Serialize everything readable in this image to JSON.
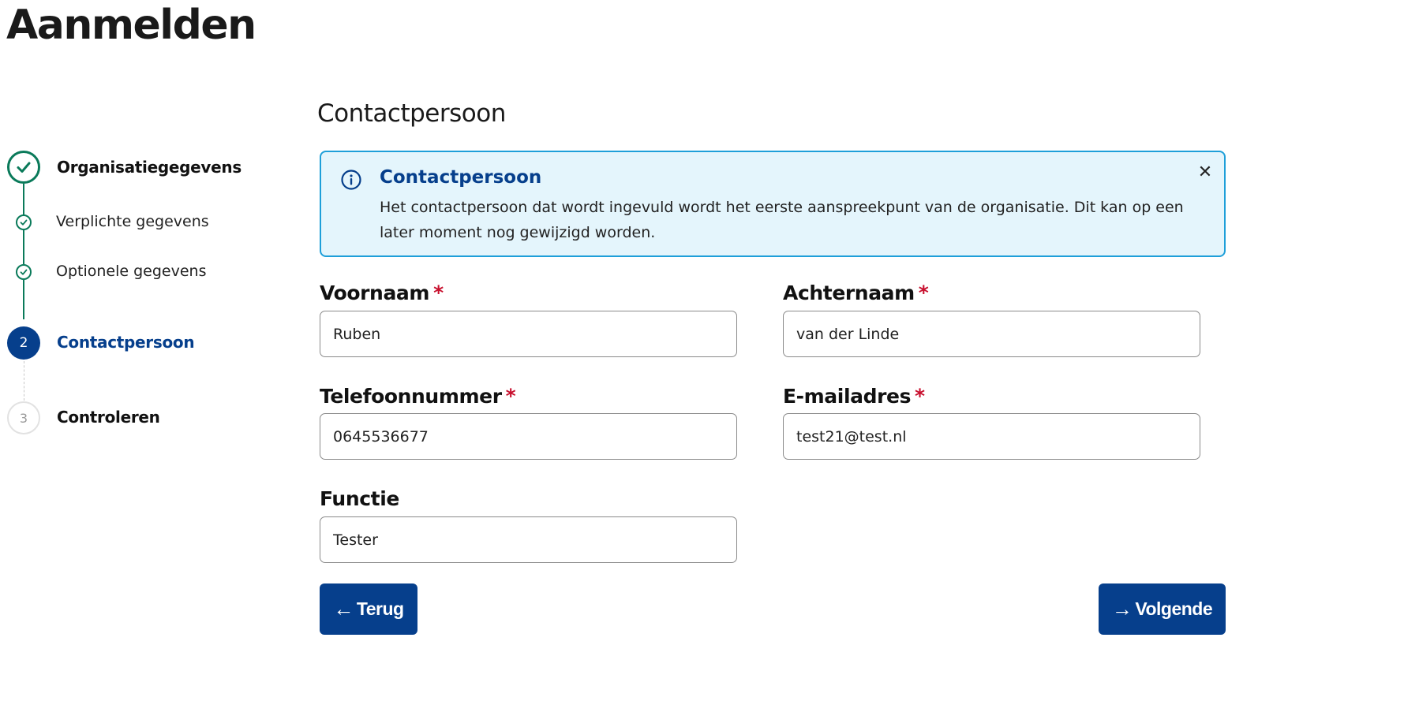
{
  "page": {
    "title": "Aanmelden"
  },
  "stepper": {
    "steps": [
      {
        "label": "Organisatiegegevens",
        "state": "done"
      },
      {
        "label": "Verplichte gegevens",
        "state": "done-sub"
      },
      {
        "label": "Optionele gegevens",
        "state": "done-sub"
      },
      {
        "label": "Contactpersoon",
        "number": "2",
        "state": "active"
      },
      {
        "label": "Controleren",
        "number": "3",
        "state": "todo"
      }
    ]
  },
  "section": {
    "title": "Contactpersoon"
  },
  "alert": {
    "title": "Contactpersoon",
    "text": "Het contactpersoon dat wordt ingevuld wordt het eerste aanspreekpunt van de organisatie. Dit kan op een later moment nog gewijzigd worden.",
    "close": "✕"
  },
  "form": {
    "required_mark": "*",
    "voornaam": {
      "label": "Voornaam",
      "value": "Ruben"
    },
    "achternaam": {
      "label": "Achternaam",
      "value": "van der Linde"
    },
    "telefoon": {
      "label": "Telefoonnummer",
      "value": "0645536677"
    },
    "email": {
      "label": "E-mailadres",
      "value": "test21@test.nl"
    },
    "functie": {
      "label": "Functie",
      "value": "Tester"
    }
  },
  "buttons": {
    "back": {
      "label": "Terug",
      "arrow": "←"
    },
    "next": {
      "label": "Volgende",
      "arrow": "→"
    }
  },
  "colors": {
    "primary": "#063f8c",
    "success": "#0a7a5a",
    "info_border": "#1e9fd9",
    "info_bg": "#e4f5fc",
    "required": "#c8102e"
  }
}
